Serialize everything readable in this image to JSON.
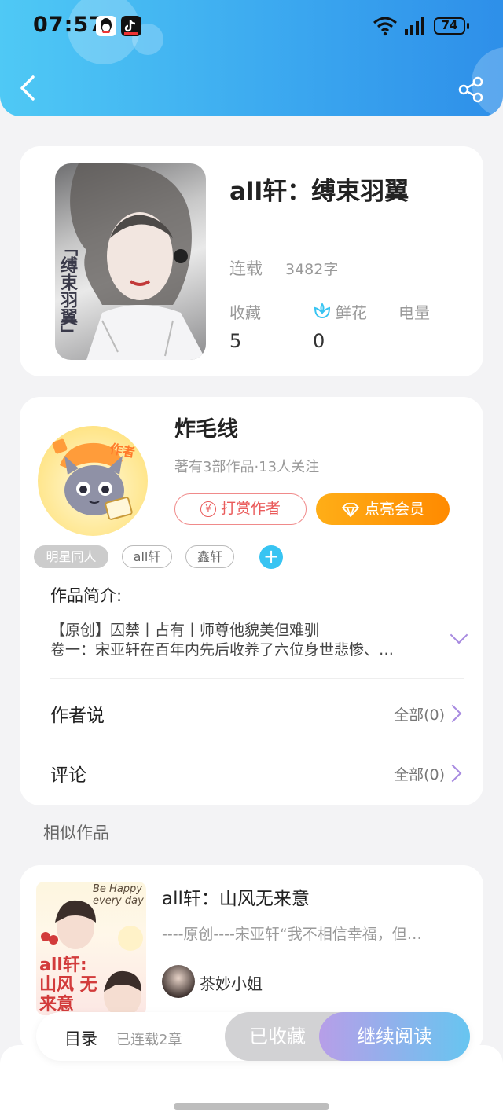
{
  "status_bar": {
    "time": "07:57",
    "battery": "74",
    "apps": [
      "qq-icon",
      "douyin-icon"
    ]
  },
  "book": {
    "title": "all轩：缚束羽翼",
    "cover_text": "「缚束羽翼」",
    "status": "连载",
    "word_count": "3482字",
    "stats": [
      {
        "label": "收藏",
        "value": "5"
      },
      {
        "label": "鲜花",
        "value": "0"
      },
      {
        "label": "电量",
        "value": ""
      }
    ]
  },
  "author": {
    "name": "炸毛线",
    "badge": "作者",
    "meta": "著有3部作品·13人关注",
    "tip_label": "打赏作者",
    "vip_label": "点亮会员"
  },
  "tags": [
    "明星同人",
    "all轩",
    "鑫轩"
  ],
  "synopsis": {
    "label": "作品简介:",
    "line1": "【原创】囚禁丨占有丨师尊他貌美但难驯",
    "line2": "卷一：宋亚轩在百年内先后收养了六位身世悲惨、…"
  },
  "rows": {
    "author_says": {
      "label": "作者说",
      "link": "全部(0)"
    },
    "comments": {
      "label": "评论",
      "link": "全部(0)"
    }
  },
  "similar": {
    "label": "相似作品",
    "items": [
      {
        "title": "all轩：山风无来意",
        "desc": "----原创----宋亚轩“我不相信幸福，但…",
        "author": "茶妙小姐",
        "cover_text_top": "Be Happy every day",
        "cover_text_main": "all轩: 山风 无来意"
      }
    ]
  },
  "bottom_bar": {
    "toc_label": "目录",
    "toc_sub": "已连载2章",
    "fav_label": "已收藏",
    "read_label": "继续阅读"
  },
  "colors": {
    "header": "#3aa6ef",
    "accent_purple": "#a78ae0",
    "vip_orange": "#ff9a0a",
    "tip_red": "#ea5b5b"
  }
}
